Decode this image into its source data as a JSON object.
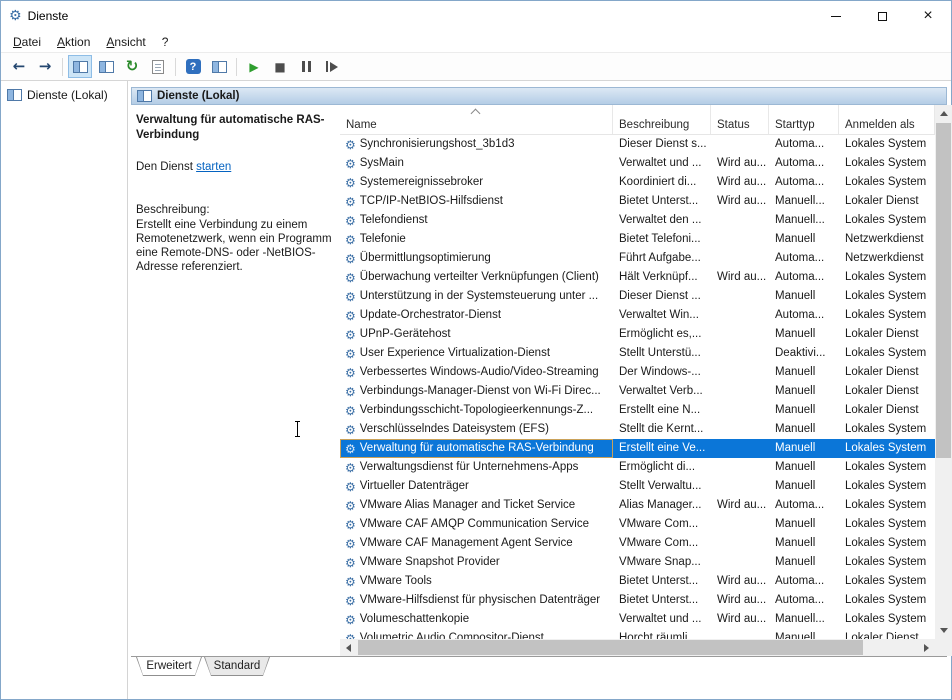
{
  "titlebar": {
    "title": "Dienste"
  },
  "menubar": {
    "items": [
      "Datei",
      "Aktion",
      "Ansicht",
      "?"
    ]
  },
  "toolbar": {
    "glyphs": {
      "back": "←",
      "forward": "→",
      "refresh": "↻",
      "help": "?",
      "start": "▶",
      "stop": "■"
    }
  },
  "icons": {
    "gear": "⚙",
    "close": "×"
  },
  "tree": {
    "root_label": "Dienste (Lokal)"
  },
  "panel": {
    "header_label": "Dienste (Lokal)"
  },
  "info": {
    "title": "Verwaltung für automatische RAS-Verbindung",
    "start_prefix": "Den Dienst ",
    "start_link": "starten",
    "description_label": "Beschreibung:",
    "description": "Erstellt eine Verbindung zu einem Remotenetzwerk, wenn ein Programm eine Remote-DNS- oder -NetBIOS-Adresse referenziert."
  },
  "table": {
    "columns": [
      "Name",
      "Beschreibung",
      "Status",
      "Starttyp",
      "Anmelden als"
    ],
    "rows": [
      {
        "name": "Synchronisierungshost_3b1d3",
        "beschreibung": "Dieser Dienst s...",
        "status": "",
        "starttyp": "Automa...",
        "anmelden": "Lokales System"
      },
      {
        "name": "SysMain",
        "beschreibung": "Verwaltet und ...",
        "status": "Wird au...",
        "starttyp": "Automa...",
        "anmelden": "Lokales System"
      },
      {
        "name": "Systemereignissebroker",
        "beschreibung": "Koordiniert di...",
        "status": "Wird au...",
        "starttyp": "Automa...",
        "anmelden": "Lokales System"
      },
      {
        "name": "TCP/IP-NetBIOS-Hilfsdienst",
        "beschreibung": "Bietet Unterst...",
        "status": "Wird au...",
        "starttyp": "Manuell...",
        "anmelden": "Lokaler Dienst"
      },
      {
        "name": "Telefondienst",
        "beschreibung": "Verwaltet den ...",
        "status": "",
        "starttyp": "Manuell...",
        "anmelden": "Lokales System"
      },
      {
        "name": "Telefonie",
        "beschreibung": "Bietet Telefoni...",
        "status": "",
        "starttyp": "Manuell",
        "anmelden": "Netzwerkdienst"
      },
      {
        "name": "Übermittlungsoptimierung",
        "beschreibung": "Führt Aufgabe...",
        "status": "",
        "starttyp": "Automa...",
        "anmelden": "Netzwerkdienst"
      },
      {
        "name": "Überwachung verteilter Verknüpfungen (Client)",
        "beschreibung": "Hält Verknüpf...",
        "status": "Wird au...",
        "starttyp": "Automa...",
        "anmelden": "Lokales System"
      },
      {
        "name": "Unterstützung in der Systemsteuerung unter ...",
        "beschreibung": "Dieser Dienst ...",
        "status": "",
        "starttyp": "Manuell",
        "anmelden": "Lokales System"
      },
      {
        "name": "Update-Orchestrator-Dienst",
        "beschreibung": "Verwaltet Win...",
        "status": "",
        "starttyp": "Automa...",
        "anmelden": "Lokales System"
      },
      {
        "name": "UPnP-Gerätehost",
        "beschreibung": "Ermöglicht es,...",
        "status": "",
        "starttyp": "Manuell",
        "anmelden": "Lokaler Dienst"
      },
      {
        "name": "User Experience Virtualization-Dienst",
        "beschreibung": "Stellt Unterstü...",
        "status": "",
        "starttyp": "Deaktivi...",
        "anmelden": "Lokales System"
      },
      {
        "name": "Verbessertes Windows-Audio/Video-Streaming",
        "beschreibung": "Der Windows-...",
        "status": "",
        "starttyp": "Manuell",
        "anmelden": "Lokaler Dienst"
      },
      {
        "name": "Verbindungs-Manager-Dienst von Wi-Fi Direc...",
        "beschreibung": "Verwaltet Verb...",
        "status": "",
        "starttyp": "Manuell",
        "anmelden": "Lokaler Dienst"
      },
      {
        "name": "Verbindungsschicht-Topologieerkennungs-Z...",
        "beschreibung": "Erstellt eine N...",
        "status": "",
        "starttyp": "Manuell",
        "anmelden": "Lokaler Dienst"
      },
      {
        "name": "Verschlüsselndes Dateisystem (EFS)",
        "beschreibung": "Stellt die Kernt...",
        "status": "",
        "starttyp": "Manuell",
        "anmelden": "Lokales System"
      },
      {
        "name": "Verwaltung für automatische RAS-Verbindung",
        "beschreibung": "Erstellt eine Ve...",
        "status": "",
        "starttyp": "Manuell",
        "anmelden": "Lokales System",
        "selected": true
      },
      {
        "name": "Verwaltungsdienst für Unternehmens-Apps",
        "beschreibung": "Ermöglicht di...",
        "status": "",
        "starttyp": "Manuell",
        "anmelden": "Lokales System"
      },
      {
        "name": "Virtueller Datenträger",
        "beschreibung": "Stellt Verwaltu...",
        "status": "",
        "starttyp": "Manuell",
        "anmelden": "Lokales System"
      },
      {
        "name": "VMware Alias Manager and Ticket Service",
        "beschreibung": "Alias Manager...",
        "status": "Wird au...",
        "starttyp": "Automa...",
        "anmelden": "Lokales System"
      },
      {
        "name": "VMware CAF AMQP Communication Service",
        "beschreibung": "VMware Com...",
        "status": "",
        "starttyp": "Manuell",
        "anmelden": "Lokales System"
      },
      {
        "name": "VMware CAF Management Agent Service",
        "beschreibung": "VMware Com...",
        "status": "",
        "starttyp": "Manuell",
        "anmelden": "Lokales System"
      },
      {
        "name": "VMware Snapshot Provider",
        "beschreibung": "VMware Snap...",
        "status": "",
        "starttyp": "Manuell",
        "anmelden": "Lokales System"
      },
      {
        "name": "VMware Tools",
        "beschreibung": "Bietet Unterst...",
        "status": "Wird au...",
        "starttyp": "Automa...",
        "anmelden": "Lokales System"
      },
      {
        "name": "VMware-Hilfsdienst für physischen Datenträger",
        "beschreibung": "Bietet Unterst...",
        "status": "Wird au...",
        "starttyp": "Automa...",
        "anmelden": "Lokales System"
      },
      {
        "name": "Volumeschattenkopie",
        "beschreibung": "Verwaltet und ...",
        "status": "Wird au...",
        "starttyp": "Manuell...",
        "anmelden": "Lokales System"
      },
      {
        "name": "Volumetric Audio Compositor-Dienst",
        "beschreibung": "Horcht räumli...",
        "status": "",
        "starttyp": "Manuell...",
        "anmelden": "Lokaler Dienst"
      }
    ]
  },
  "tabs": {
    "items": [
      "Erweitert",
      "Standard"
    ],
    "active_index": 0
  },
  "colors": {
    "selection": "#0b76d8",
    "header_top": "#dce8f4",
    "header_bottom": "#b4cde6",
    "link": "#0563c1"
  }
}
